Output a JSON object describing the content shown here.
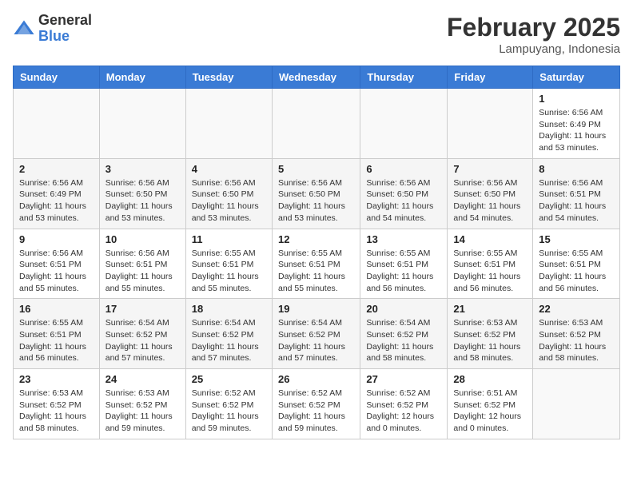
{
  "header": {
    "logo_general": "General",
    "logo_blue": "Blue",
    "month_year": "February 2025",
    "location": "Lampuyang, Indonesia"
  },
  "days_of_week": [
    "Sunday",
    "Monday",
    "Tuesday",
    "Wednesday",
    "Thursday",
    "Friday",
    "Saturday"
  ],
  "weeks": [
    [
      {
        "day": "",
        "info": ""
      },
      {
        "day": "",
        "info": ""
      },
      {
        "day": "",
        "info": ""
      },
      {
        "day": "",
        "info": ""
      },
      {
        "day": "",
        "info": ""
      },
      {
        "day": "",
        "info": ""
      },
      {
        "day": "1",
        "info": "Sunrise: 6:56 AM\nSunset: 6:49 PM\nDaylight: 11 hours\nand 53 minutes."
      }
    ],
    [
      {
        "day": "2",
        "info": "Sunrise: 6:56 AM\nSunset: 6:49 PM\nDaylight: 11 hours\nand 53 minutes."
      },
      {
        "day": "3",
        "info": "Sunrise: 6:56 AM\nSunset: 6:50 PM\nDaylight: 11 hours\nand 53 minutes."
      },
      {
        "day": "4",
        "info": "Sunrise: 6:56 AM\nSunset: 6:50 PM\nDaylight: 11 hours\nand 53 minutes."
      },
      {
        "day": "5",
        "info": "Sunrise: 6:56 AM\nSunset: 6:50 PM\nDaylight: 11 hours\nand 53 minutes."
      },
      {
        "day": "6",
        "info": "Sunrise: 6:56 AM\nSunset: 6:50 PM\nDaylight: 11 hours\nand 54 minutes."
      },
      {
        "day": "7",
        "info": "Sunrise: 6:56 AM\nSunset: 6:50 PM\nDaylight: 11 hours\nand 54 minutes."
      },
      {
        "day": "8",
        "info": "Sunrise: 6:56 AM\nSunset: 6:51 PM\nDaylight: 11 hours\nand 54 minutes."
      }
    ],
    [
      {
        "day": "9",
        "info": "Sunrise: 6:56 AM\nSunset: 6:51 PM\nDaylight: 11 hours\nand 55 minutes."
      },
      {
        "day": "10",
        "info": "Sunrise: 6:56 AM\nSunset: 6:51 PM\nDaylight: 11 hours\nand 55 minutes."
      },
      {
        "day": "11",
        "info": "Sunrise: 6:55 AM\nSunset: 6:51 PM\nDaylight: 11 hours\nand 55 minutes."
      },
      {
        "day": "12",
        "info": "Sunrise: 6:55 AM\nSunset: 6:51 PM\nDaylight: 11 hours\nand 55 minutes."
      },
      {
        "day": "13",
        "info": "Sunrise: 6:55 AM\nSunset: 6:51 PM\nDaylight: 11 hours\nand 56 minutes."
      },
      {
        "day": "14",
        "info": "Sunrise: 6:55 AM\nSunset: 6:51 PM\nDaylight: 11 hours\nand 56 minutes."
      },
      {
        "day": "15",
        "info": "Sunrise: 6:55 AM\nSunset: 6:51 PM\nDaylight: 11 hours\nand 56 minutes."
      }
    ],
    [
      {
        "day": "16",
        "info": "Sunrise: 6:55 AM\nSunset: 6:51 PM\nDaylight: 11 hours\nand 56 minutes."
      },
      {
        "day": "17",
        "info": "Sunrise: 6:54 AM\nSunset: 6:52 PM\nDaylight: 11 hours\nand 57 minutes."
      },
      {
        "day": "18",
        "info": "Sunrise: 6:54 AM\nSunset: 6:52 PM\nDaylight: 11 hours\nand 57 minutes."
      },
      {
        "day": "19",
        "info": "Sunrise: 6:54 AM\nSunset: 6:52 PM\nDaylight: 11 hours\nand 57 minutes."
      },
      {
        "day": "20",
        "info": "Sunrise: 6:54 AM\nSunset: 6:52 PM\nDaylight: 11 hours\nand 58 minutes."
      },
      {
        "day": "21",
        "info": "Sunrise: 6:53 AM\nSunset: 6:52 PM\nDaylight: 11 hours\nand 58 minutes."
      },
      {
        "day": "22",
        "info": "Sunrise: 6:53 AM\nSunset: 6:52 PM\nDaylight: 11 hours\nand 58 minutes."
      }
    ],
    [
      {
        "day": "23",
        "info": "Sunrise: 6:53 AM\nSunset: 6:52 PM\nDaylight: 11 hours\nand 58 minutes."
      },
      {
        "day": "24",
        "info": "Sunrise: 6:53 AM\nSunset: 6:52 PM\nDaylight: 11 hours\nand 59 minutes."
      },
      {
        "day": "25",
        "info": "Sunrise: 6:52 AM\nSunset: 6:52 PM\nDaylight: 11 hours\nand 59 minutes."
      },
      {
        "day": "26",
        "info": "Sunrise: 6:52 AM\nSunset: 6:52 PM\nDaylight: 11 hours\nand 59 minutes."
      },
      {
        "day": "27",
        "info": "Sunrise: 6:52 AM\nSunset: 6:52 PM\nDaylight: 12 hours\nand 0 minutes."
      },
      {
        "day": "28",
        "info": "Sunrise: 6:51 AM\nSunset: 6:52 PM\nDaylight: 12 hours\nand 0 minutes."
      },
      {
        "day": "",
        "info": ""
      }
    ]
  ]
}
